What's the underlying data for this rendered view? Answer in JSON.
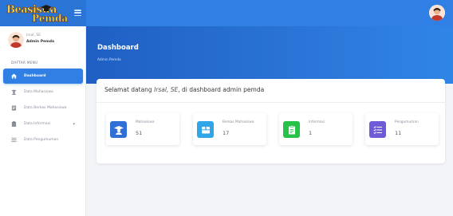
{
  "brand": {
    "word1": "Beasiswa",
    "word2": "Pemda"
  },
  "user": {
    "name": "Irsal, SE",
    "role": "Admin Pemda"
  },
  "sidebar": {
    "menu_title": "DAFTAR MENU",
    "items": [
      {
        "label": "Dashboard",
        "icon": "home-icon",
        "active": true
      },
      {
        "label": "Data Mahasiswa",
        "icon": "graduate-icon"
      },
      {
        "label": "Data Berkas Mahasiswa",
        "icon": "document-icon"
      },
      {
        "label": "Data Informasi",
        "icon": "clipboard-icon",
        "caret": "▾"
      },
      {
        "label": "Data Pengumuman",
        "icon": "list-icon"
      }
    ]
  },
  "header": {
    "title": "Dashboard",
    "breadcrumb": "Admin Pemda"
  },
  "welcome": {
    "prefix": "Selamat datang ",
    "name": "Irsal, SE",
    "suffix": ", di dashboard admin pemda"
  },
  "stats": [
    {
      "label": "Mahasiswa",
      "value": "51",
      "color": "#2f6fd6",
      "icon": "graduate-icon"
    },
    {
      "label": "Berkas Mahasiswa",
      "value": "17",
      "color": "#2fa6e8",
      "icon": "folder-icon"
    },
    {
      "label": "Informasi",
      "value": "1",
      "color": "#27c24a",
      "icon": "clipboard-icon"
    },
    {
      "label": "Pengumuman",
      "value": "11",
      "color": "#6f5ad8",
      "icon": "checklist-icon"
    }
  ],
  "colors": {
    "primary": "#2f7fe4",
    "header_dark": "#1f5fc4"
  }
}
